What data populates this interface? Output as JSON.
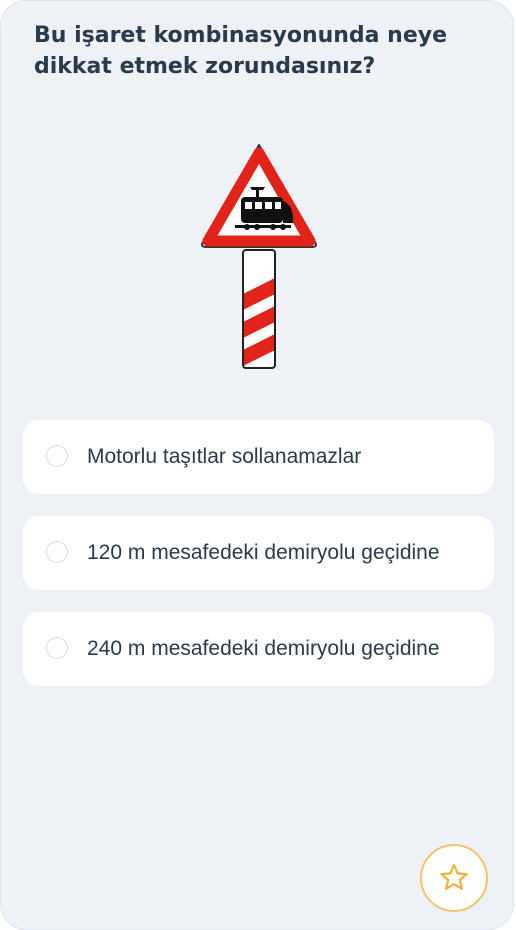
{
  "question": {
    "text": "Bu işaret kombinasyonunda neye dikkat etmek zorundasınız?"
  },
  "image": {
    "icon": "railroad-crossing-warning-sign-icon"
  },
  "options": [
    {
      "label": "Motorlu taşıtlar sollanamazlar"
    },
    {
      "label": "120 m mesafedeki demiryolu geçidine"
    },
    {
      "label": "240 m mesafedeki demiryolu geçidine"
    }
  ],
  "favorite": {
    "icon": "star-icon"
  },
  "colors": {
    "background": "#eef2f6",
    "option_background": "#ffffff",
    "text": "#2b3a4a",
    "radio_border": "#d6dde5",
    "sign_red": "#e2231a",
    "star_accent": "#f3c46b"
  }
}
